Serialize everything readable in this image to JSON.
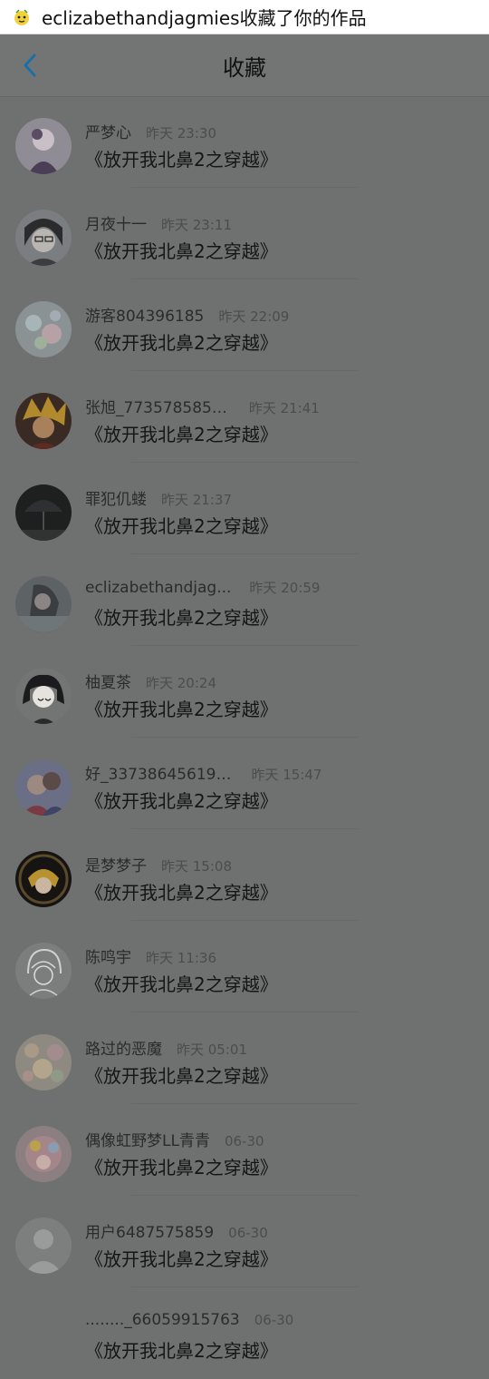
{
  "banner": {
    "text": "eclizabethandjagmies收藏了你的作品",
    "icon": "notification-app-icon"
  },
  "header": {
    "title": "收藏",
    "back_icon": "chevron-left-icon",
    "accent": "#1a6fa8"
  },
  "items": [
    {
      "name": "严梦心",
      "time": "昨天 23:30",
      "work": "《放开我北鼻2之穿越》",
      "avatar": "avatar-anime-girl"
    },
    {
      "name": "月夜十一",
      "time": "昨天 23:11",
      "work": "《放开我北鼻2之穿越》",
      "avatar": "avatar-glasses-boy"
    },
    {
      "name": "游客804396185",
      "time": "昨天 22:09",
      "work": "《放开我北鼻2之穿越》",
      "avatar": "avatar-flowers"
    },
    {
      "name": "张旭_773578585…",
      "time": "昨天 21:41",
      "work": "《放开我北鼻2之穿越》",
      "avatar": "avatar-blonde-anime"
    },
    {
      "name": "罪犯仉蝼",
      "time": "昨天 21:37",
      "work": "《放开我北鼻2之穿越》",
      "avatar": "avatar-dark-scene"
    },
    {
      "name": "eclizabethandjag...",
      "time": "昨天 20:59",
      "work": "《放开我北鼻2之穿越》",
      "avatar": "avatar-portrait"
    },
    {
      "name": "柚夏茶",
      "time": "昨天 20:24",
      "work": "《放开我北鼻2之穿越》",
      "avatar": "avatar-chibi"
    },
    {
      "name": "好_33738645619…",
      "time": "昨天 15:47",
      "work": "《放开我北鼻2之穿越》",
      "avatar": "avatar-couple"
    },
    {
      "name": "是梦梦子",
      "time": "昨天 15:08",
      "work": "《放开我北鼻2之穿越》",
      "avatar": "avatar-ornate-anime"
    },
    {
      "name": "陈鸣宇",
      "time": "昨天 11:36",
      "work": "《放开我北鼻2之穿越》",
      "avatar": "avatar-sketch"
    },
    {
      "name": "路过的恶魔",
      "time": "昨天 05:01",
      "work": "《放开我北鼻2之穿越》",
      "avatar": "avatar-pastel-flowers"
    },
    {
      "name": "偶像虹野梦LL青青",
      "time": "06-30",
      "work": "《放开我北鼻2之穿越》",
      "avatar": "avatar-colorful-idol"
    },
    {
      "name": "用户6487575859",
      "time": "06-30",
      "work": "《放开我北鼻2之穿越》",
      "avatar": "default-user-icon"
    },
    {
      "name": "........_66059915763",
      "time": "06-30",
      "work": "《放开我北鼻2之穿越》",
      "avatar": "avatar-none"
    }
  ]
}
